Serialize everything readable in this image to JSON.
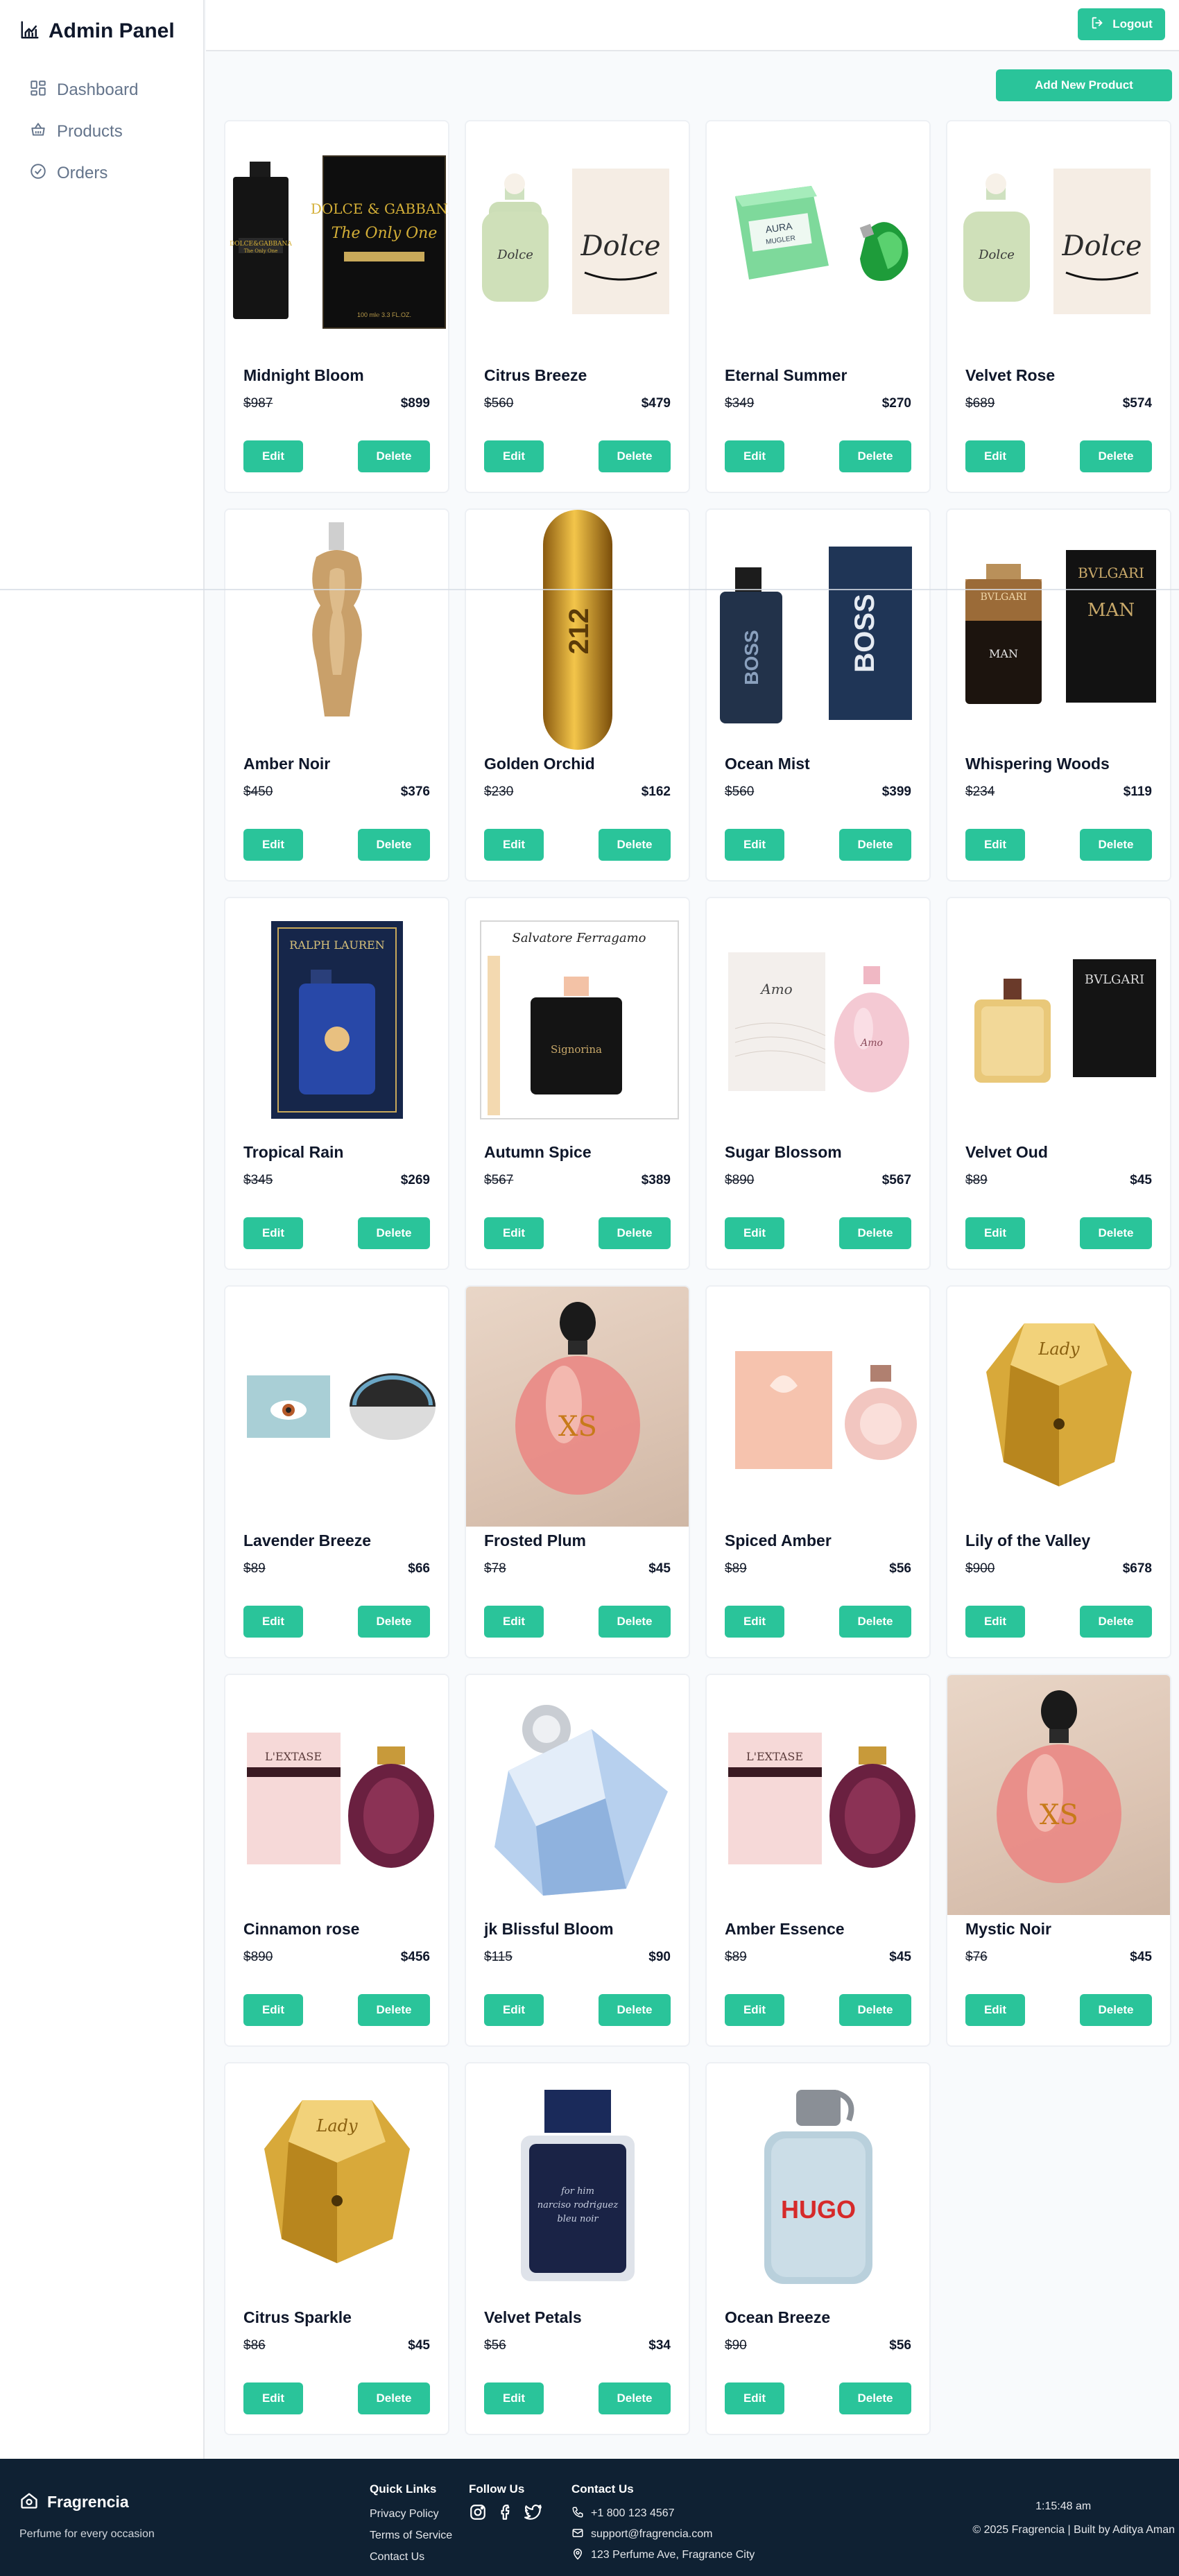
{
  "sidebar": {
    "title": "Admin Panel",
    "items": [
      {
        "label": "Dashboard",
        "icon": "dashboard-icon"
      },
      {
        "label": "Products",
        "icon": "basket-icon"
      },
      {
        "label": "Orders",
        "icon": "check-circle-icon"
      }
    ]
  },
  "header": {
    "logout_label": "Logout"
  },
  "main": {
    "add_label": "Add New Product"
  },
  "products": [
    {
      "name": "Midnight Bloom",
      "old": "$987",
      "new": "$899"
    },
    {
      "name": "Citrus Breeze",
      "old": "$560",
      "new": "$479"
    },
    {
      "name": "Eternal Summer",
      "old": "$349",
      "new": "$270"
    },
    {
      "name": "Velvet Rose",
      "old": "$689",
      "new": "$574"
    },
    {
      "name": "Amber Noir",
      "old": "$450",
      "new": "$376"
    },
    {
      "name": "Golden Orchid",
      "old": "$230",
      "new": "$162"
    },
    {
      "name": "Ocean Mist",
      "old": "$560",
      "new": "$399"
    },
    {
      "name": "Whispering Woods",
      "old": "$234",
      "new": "$119"
    },
    {
      "name": "Tropical Rain",
      "old": "$345",
      "new": "$269"
    },
    {
      "name": "Autumn Spice",
      "old": "$567",
      "new": "$389"
    },
    {
      "name": "Sugar Blossom",
      "old": "$890",
      "new": "$567"
    },
    {
      "name": "Velvet Oud",
      "old": "$89",
      "new": "$45"
    },
    {
      "name": "Lavender Breeze",
      "old": "$89",
      "new": "$66"
    },
    {
      "name": "Frosted Plum",
      "old": "$78",
      "new": "$45"
    },
    {
      "name": "Spiced Amber",
      "old": "$89",
      "new": "$56"
    },
    {
      "name": "Lily of the Valley",
      "old": "$900",
      "new": "$678"
    },
    {
      "name": "Cinnamon rose",
      "old": "$890",
      "new": "$456"
    },
    {
      "name": "jk Blissful Bloom",
      "old": "$115",
      "new": "$90"
    },
    {
      "name": "Amber Essence",
      "old": "$89",
      "new": "$45"
    },
    {
      "name": "Mystic Noir",
      "old": "$76",
      "new": "$45"
    },
    {
      "name": "Citrus Sparkle",
      "old": "$86",
      "new": "$45"
    },
    {
      "name": "Velvet Petals",
      "old": "$56",
      "new": "$34"
    },
    {
      "name": "Ocean Breeze",
      "old": "$90",
      "new": "$56"
    }
  ],
  "card_actions": {
    "edit": "Edit",
    "delete": "Delete"
  },
  "footer": {
    "brand": "Fragrencia",
    "tagline": "Perfume for every occasion",
    "quick_links_title": "Quick Links",
    "links": [
      "Privacy Policy",
      "Terms of Service",
      "Contact Us"
    ],
    "follow_title": "Follow Us",
    "contact_title": "Contact Us",
    "phone": "+1 800 123 4567",
    "email": "support@fragrencia.com",
    "address": "123 Perfume Ave, Fragrance City",
    "time": "1:15:48 am",
    "copyright": "© 2025 Fragrencia | Built by Aditya Aman"
  },
  "colors": {
    "accent": "#2ac49a",
    "footer_bg": "#0f2133"
  }
}
